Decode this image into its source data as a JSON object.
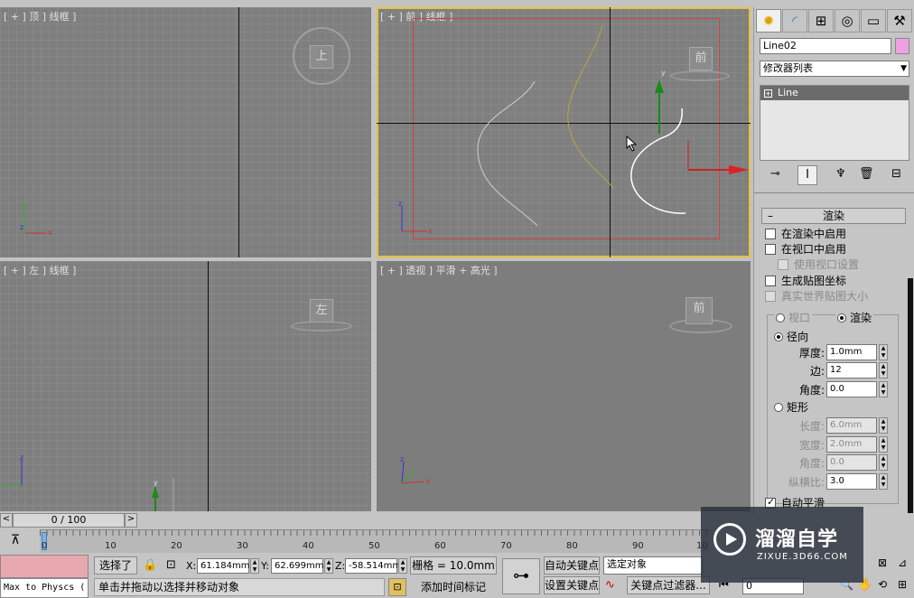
{
  "viewports": {
    "top": {
      "label": "[ + ] 顶 ] 线框 ]",
      "cube": "上"
    },
    "front": {
      "label": "[ + ] 前 ] 线框 ]",
      "cube": "前"
    },
    "left": {
      "label": "[ + ] 左 ] 线框 ]",
      "cube": "左"
    },
    "persp": {
      "label": "[ + ] 透视 ] 平滑 + 高光 ]",
      "cube": "前"
    }
  },
  "panel": {
    "tabs": [
      "create-icon",
      "modify-icon",
      "hierarchy-icon",
      "motion-icon",
      "display-icon",
      "utilities-icon"
    ],
    "object_name": "Line02",
    "color_swatch": "#f0a0e0",
    "modifier_list": "修改器列表",
    "stack_item": "Line",
    "rollout_title": "渲染",
    "enable_render": "在渲染中启用",
    "enable_viewport": "在视口中启用",
    "use_viewport_settings": "使用视口设置",
    "gen_map_coords": "生成贴图坐标",
    "real_world_map": "真实世界贴图大小",
    "opt_viewport": "视口",
    "opt_render": "渲染",
    "radial": "径向",
    "thickness_label": "厚度:",
    "thickness": "1.0mm",
    "sides_label": "边:",
    "sides": "12",
    "angle_label": "角度:",
    "angle": "0.0",
    "rect": "矩形",
    "length_label": "长度:",
    "length": "6.0mm",
    "width_label": "宽度:",
    "width": "2.0mm",
    "angle2_label": "角度:",
    "angle2": "0.0",
    "aspect_label": "纵横比:",
    "aspect": "3.0",
    "auto_smooth": "自动平滑"
  },
  "timeline": {
    "frame": "0 / 100",
    "prev": "<",
    "next": ">",
    "ticks": [
      "0",
      "10",
      "20",
      "30",
      "40",
      "50",
      "60",
      "70",
      "80",
      "90",
      "10"
    ]
  },
  "status": {
    "script": "Max to Physcs (",
    "selected": "选择了",
    "x_label": "X:",
    "x": "61.184mm",
    "y_label": "Y:",
    "y": "62.699mm",
    "z_label": "Z:",
    "z": "-58.514mm",
    "grid": "栅格 = 10.0mm",
    "auto_key": "自动关键点",
    "set_key": "设置关键点",
    "sel_obj": "选定对象",
    "key_filter": "关键点过滤器...",
    "prompt": "单击并拖动以选择并移动对象",
    "add_time_tag": "添加时间标记",
    "frame_field": "0"
  },
  "watermark": {
    "title": "溜溜自学",
    "url": "ZIXUE.3D66.COM"
  }
}
